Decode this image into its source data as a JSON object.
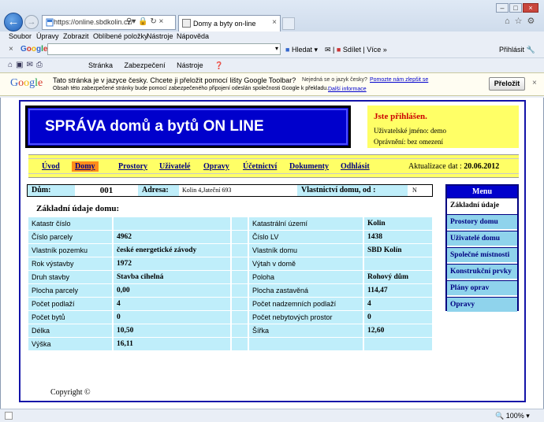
{
  "browser": {
    "url": "https://online.sbdkolin.cz/",
    "tab_title": "Domy a byty on-line",
    "menu": [
      "Soubor",
      "Úpravy",
      "Zobrazit",
      "Oblíbené položky",
      "Nástroje",
      "Nápověda"
    ],
    "google_search_label": "Hledat",
    "share_label": "Sdílet",
    "more_label": "Více",
    "signin_label": "Přihlásit",
    "cmd_menus": [
      "Stránka",
      "Zabezpečení",
      "Nástroje"
    ],
    "zoom": "100%"
  },
  "translate_bar": {
    "message": "Tato stránka je v jazyce česky. Chcete ji přeložit pomocí lišty Google Toolbar?",
    "not_czech": "Nejedná se o jazyk česky?",
    "help_link": "Pomozte nám zlepšit se",
    "privacy_note": "Obsah této zabezpečené stránky bude pomocí zabezpečeného připojení odeslán společnosti Google k překladu.",
    "more_info": "Další informace",
    "translate_button": "Přeložit"
  },
  "header": {
    "title": "SPRÁVA domů a bytů ON LINE"
  },
  "login": {
    "status": "Jste přihlášen.",
    "user": "Uživatelské jméno: demo",
    "permission": "Oprávnění: bez omezení"
  },
  "nav": {
    "items": [
      "Úvod",
      "Domy",
      "Prostory",
      "Uživatelé",
      "Opravy",
      "Účetnictví",
      "Dokumenty",
      "Odhlásit"
    ],
    "update_label": "Aktualizace dat :",
    "update_date": "20.06.2012"
  },
  "info": {
    "house_label": "Dům:",
    "house_value": "001",
    "address_label": "Adresa:",
    "address_value": "Kolin 4,Jateční 693",
    "ownership_label": "Vlastnictví domu, od :",
    "ownership_value": "N"
  },
  "main": {
    "heading": "Základní údaje domu:",
    "rows": [
      {
        "l1": "Katastr číslo",
        "v1": "",
        "l2": "Katastrální území",
        "v2": "Kolin"
      },
      {
        "l1": "Číslo parcely",
        "v1": "4962",
        "l2": "Číslo LV",
        "v2": "1438"
      },
      {
        "l1": "Vlastník pozemku",
        "v1": "české energetické závody",
        "l2": "Vlastník domu",
        "v2": "SBD Kolín"
      },
      {
        "l1": "Rok výstavby",
        "v1": "1972",
        "l2": "Výtah v domě",
        "v2": ""
      },
      {
        "l1": "Druh stavby",
        "v1": "Stavba cihelná",
        "l2": "Poloha",
        "v2": "Rohový dům"
      },
      {
        "l1": "Plocha parcely",
        "v1": "0,00",
        "l2": "Plocha zastavěná",
        "v2": "114,47"
      },
      {
        "l1": "Počet podlaží",
        "v1": "4",
        "l2": "Počet nadzemních podlaží",
        "v2": "4"
      },
      {
        "l1": "Počet bytů",
        "v1": "0",
        "l2": "Počet nebytových prostor",
        "v2": "0"
      },
      {
        "l1": "Délka",
        "v1": "10,50",
        "l2": "Šířka",
        "v2": "12,60"
      },
      {
        "l1": "Výška",
        "v1": "16,11",
        "l2": "",
        "v2": ""
      }
    ]
  },
  "side_menu": {
    "title": "Menu",
    "items": [
      "Základní údaje",
      "Prostory domu",
      "Uživatelé domu",
      "Společné místnosti",
      "Konstrukční prvky",
      "Plány oprav",
      "Opravy"
    ]
  },
  "footer": {
    "copyright": "Copyright ©"
  }
}
